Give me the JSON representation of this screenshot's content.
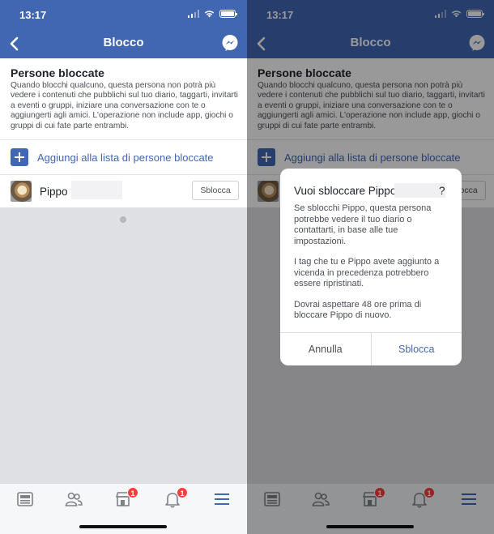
{
  "status_bar": {
    "time": "13:17"
  },
  "navbar": {
    "title": "Blocco"
  },
  "blocked_section": {
    "title": "Persone bloccate",
    "description": "Quando blocchi qualcuno, questa persona non potrà più vedere i contenuti che pubblichi sul tuo diario, taggarti, invitarti a eventi o gruppi, iniziare una conversazione con te o aggiungerti agli amici. L'operazione non include app, giochi o gruppi di cui fate parte entrambi.",
    "add_label": "Aggiungi alla lista di persone bloccate",
    "person_name": "Pippo",
    "unblock_label": "Sblocca"
  },
  "tabbar": {
    "items": [
      {
        "icon": "news-feed-icon",
        "badge": ""
      },
      {
        "icon": "friends-icon",
        "badge": ""
      },
      {
        "icon": "marketplace-icon",
        "badge": "1"
      },
      {
        "icon": "notifications-bell-icon",
        "badge": "1"
      },
      {
        "icon": "menu-icon",
        "badge": ""
      }
    ]
  },
  "dialog": {
    "title": "Vuoi sbloccare Pippo",
    "title_suffix": "?",
    "paragraph1": "Se sblocchi Pippo, questa persona potrebbe vedere il tuo diario o contattarti, in base alle tue impostazioni.",
    "paragraph2": "I tag che tu e Pippo avete aggiunto a vicenda in precedenza potrebbero essere ripristinati.",
    "paragraph3": "Dovrai aspettare 48 ore prima di bloccare Pippo di nuovo.",
    "cancel_label": "Annulla",
    "confirm_label": "Sblocca"
  },
  "colors": {
    "accent": "#4267b2",
    "badge": "#fa3e3e",
    "background": "#dfe0e4"
  }
}
